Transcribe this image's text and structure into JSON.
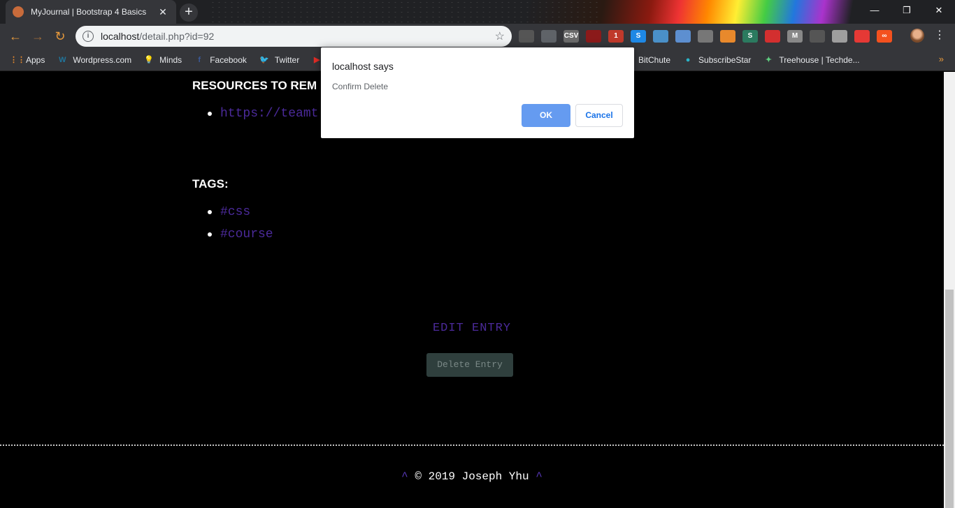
{
  "browser": {
    "tab_title": "MyJournal | Bootstrap 4 Basics",
    "close_glyph": "✕",
    "new_tab_glyph": "+",
    "window_controls": [
      "—",
      "❐",
      "✕"
    ],
    "url_host": "localhost",
    "url_path": "/detail.php?id=92",
    "info_glyph": "i",
    "star_glyph": "☆",
    "back_glyph": "←",
    "forward_glyph": "→",
    "reload_glyph": "↻",
    "menu_glyph": "⋮",
    "extensions": [
      {
        "icon": "extension-icon",
        "color": "#555555",
        "text": ""
      },
      {
        "icon": "shield-icon",
        "color": "#5f6368",
        "text": ""
      },
      {
        "icon": "csv-icon",
        "color": "#6b6b6b",
        "text": "CSV"
      },
      {
        "icon": "pdf-icon",
        "color": "#8b1a1a",
        "text": ""
      },
      {
        "icon": "calendar-icon",
        "color": "#c0392b",
        "text": "1"
      },
      {
        "icon": "skype-icon",
        "color": "#1e88e5",
        "text": "S"
      },
      {
        "icon": "window-icon",
        "color": "#4a90c8",
        "text": ""
      },
      {
        "icon": "image-icon",
        "color": "#5d8fd0",
        "text": ""
      },
      {
        "icon": "wrench-icon",
        "color": "#777777",
        "text": ""
      },
      {
        "icon": "mountain-icon",
        "color": "#e8892c",
        "text": ""
      },
      {
        "icon": "script-icon",
        "color": "#2b7a5f",
        "text": "S"
      },
      {
        "icon": "stop-hand-icon",
        "color": "#d32f2f",
        "text": ""
      },
      {
        "icon": "m-icon",
        "color": "#888888",
        "text": "M"
      },
      {
        "icon": "glasses-icon",
        "color": "#555555",
        "text": ""
      },
      {
        "icon": "chat-icon",
        "color": "#9e9e9e",
        "text": ""
      },
      {
        "icon": "ghost-icon",
        "color": "#e53935",
        "text": ""
      },
      {
        "icon": "infinity-icon",
        "color": "#f4511e",
        "text": "∞"
      }
    ],
    "bookmarks": [
      {
        "label": "Apps",
        "icon": "apps-grid-icon",
        "color": "#e8892c",
        "glyph": "⋮⋮"
      },
      {
        "label": "Wordpress.com",
        "icon": "wordpress-icon",
        "color": "#21759b",
        "glyph": "W"
      },
      {
        "label": "Minds",
        "icon": "lightbulb-icon",
        "color": "#fbc02d",
        "glyph": "💡"
      },
      {
        "label": "Facebook",
        "icon": "facebook-icon",
        "color": "#3b5998",
        "glyph": "f"
      },
      {
        "label": "Twitter",
        "icon": "twitter-icon",
        "color": "#1da1f2",
        "glyph": "🐦"
      },
      {
        "label": "",
        "icon": "youtube-icon",
        "color": "#e52d27",
        "glyph": "▶"
      }
    ],
    "bookmarks_right": [
      {
        "label": "BitChute",
        "icon": "bitchute-icon",
        "color": "#ef4137",
        "glyph": ""
      },
      {
        "label": "SubscribeStar",
        "icon": "subscribestar-icon",
        "color": "#2ab4c8",
        "glyph": "●"
      },
      {
        "label": "Treehouse | Techde...",
        "icon": "treehouse-icon",
        "color": "#5fcf80",
        "glyph": "✦"
      }
    ],
    "bookmarks_more": "»"
  },
  "page": {
    "resources_heading": "RESOURCES TO REM",
    "resources": [
      "https://teamt"
    ],
    "tags_heading": "TAGS:",
    "tags": [
      "#css",
      "#course"
    ],
    "edit_entry": "EDIT ENTRY",
    "delete_entry": "Delete Entry",
    "footer_caret_left": "^",
    "footer_text": " © 2019 Joseph Yhu ",
    "footer_caret_right": "^"
  },
  "dialog": {
    "title": "localhost says",
    "message": "Confirm Delete",
    "ok_label": "OK",
    "cancel_label": "Cancel"
  }
}
